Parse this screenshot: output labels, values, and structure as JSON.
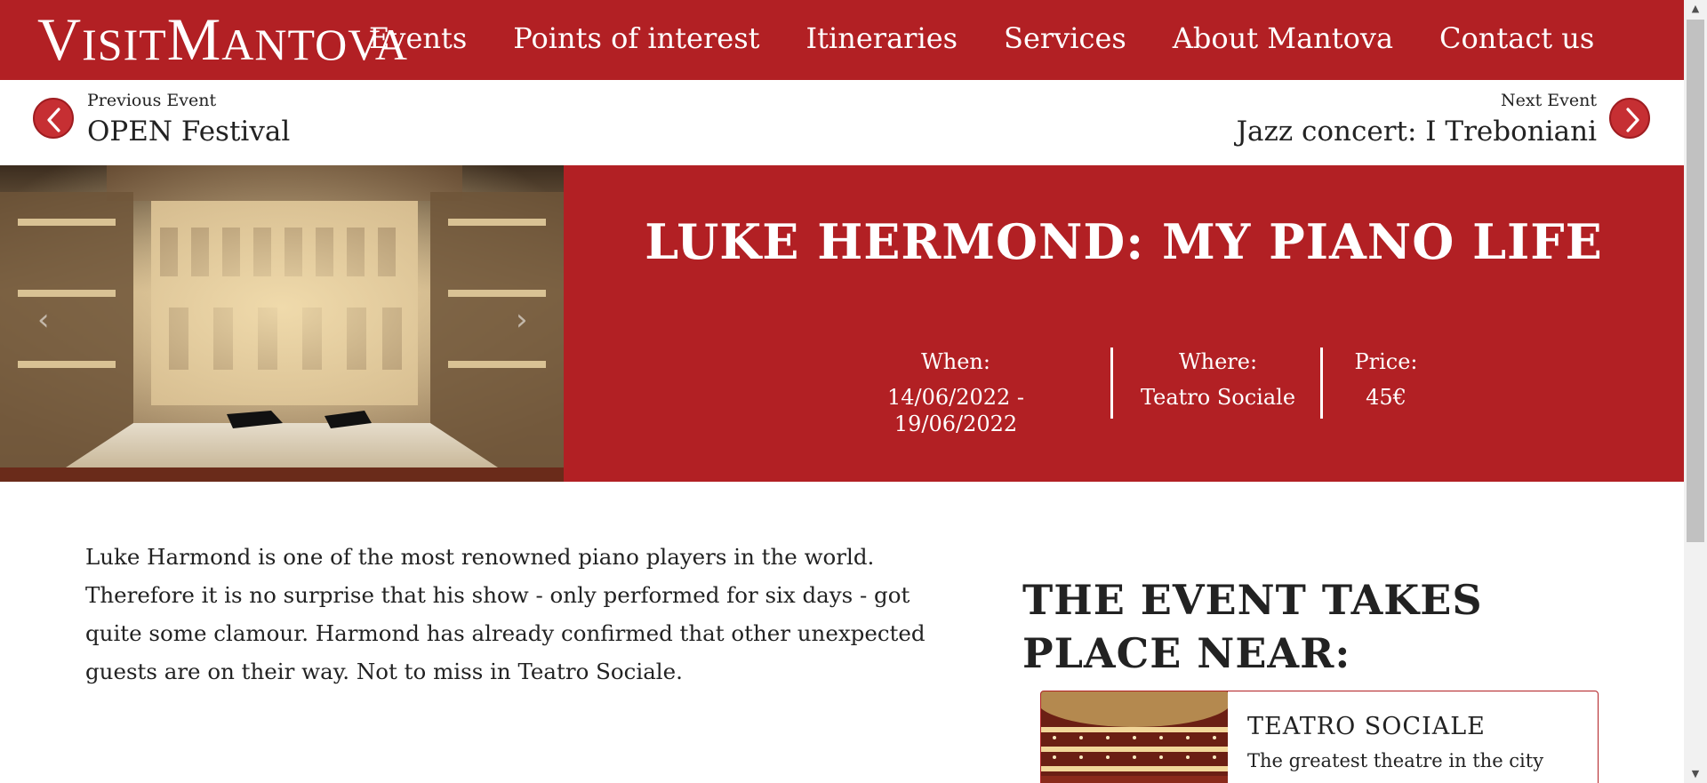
{
  "colors": {
    "brand": "#b22024",
    "text": "#222222",
    "background": "#ffffff"
  },
  "header": {
    "logo": {
      "first_cap": "V",
      "first_rest": "ISIT",
      "second_cap": "M",
      "second_rest": "ANTOVA"
    },
    "nav": [
      "Events",
      "Points of interest",
      "Itineraries",
      "Services",
      "About Mantova",
      "Contact us"
    ]
  },
  "event_nav": {
    "prev_caption": "Previous Event",
    "prev_title": "OPEN Festival",
    "next_caption": "Next Event",
    "next_title": "Jazz concert: I Treboniani",
    "prev_icon": "chevron-left-icon",
    "next_icon": "chevron-right-icon"
  },
  "event": {
    "title": "LUKE HERMOND: MY PIANO LIFE",
    "when_label": "When:",
    "when_value": "14/06/2022 - 19/06/2022",
    "where_label": "Where:",
    "where_value": "Teatro Sociale",
    "price_label": "Price:",
    "price_value": "45€",
    "description": "Luke Harmond is one of the most renowned piano players in the world. Therefore it is no surprise that his show - only performed for six days - got quite some clamour. Harmond has already confirmed that other unexpected guests are on their way. Not to miss in Teatro Sociale."
  },
  "nearby": {
    "heading": "THE EVENT TAKES PLACE NEAR:",
    "card": {
      "name": "TEATRO SOCIALE",
      "subtitle": "The greatest theatre in the city"
    }
  }
}
